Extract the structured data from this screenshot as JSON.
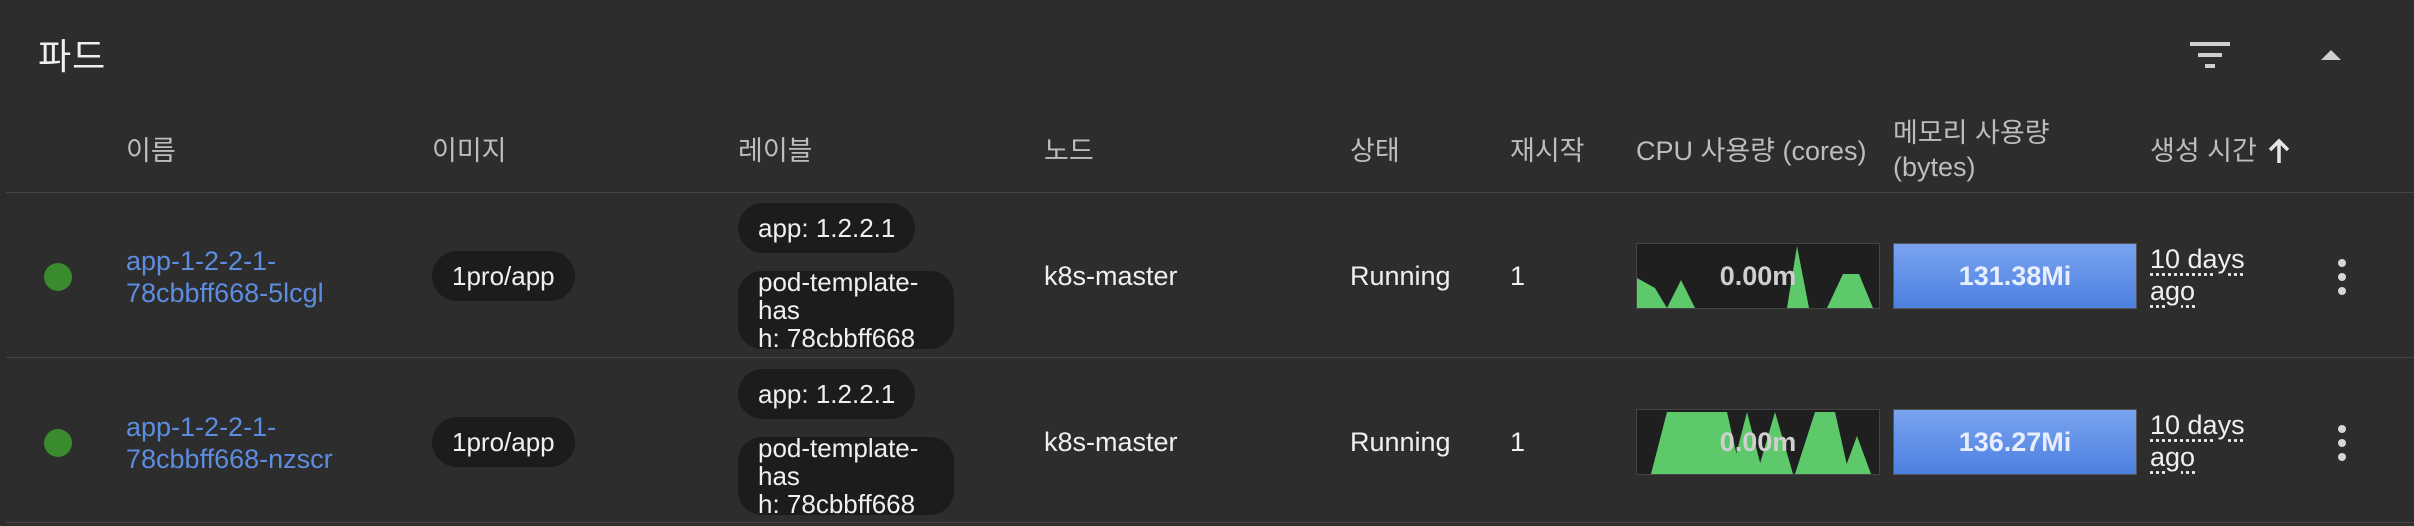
{
  "card": {
    "title": "파드"
  },
  "columns": {
    "name": "이름",
    "image": "이미지",
    "labels": "레이블",
    "node": "노드",
    "status": "상태",
    "restarts": "재시작",
    "cpu": "CPU 사용량 (cores)",
    "memory_line1": "메모리 사용량",
    "memory_line2": "(bytes)",
    "created": "생성 시간",
    "sort_icon": "arrow-up-icon"
  },
  "icons": {
    "filter": "filter-icon",
    "collapse": "chevron-up-icon",
    "status": "status-dot-icon",
    "menu": "more-vertical-icon"
  },
  "colors": {
    "status_running": "#3a8a2e",
    "link": "#5c8de0",
    "cpu_graph": "#5dc96a",
    "memory_bar": "#6a97ea"
  },
  "rows": [
    {
      "name_line1": "app-1-2-2-1-",
      "name_line2": "78cbbff668-5lcgl",
      "image": "1pro/app",
      "label1": "app: 1.2.2.1",
      "label2_line1": "pod-template-has",
      "label2_line2": "h: 78cbbff668",
      "node": "k8s-master",
      "status": "Running",
      "restarts": "1",
      "cpu": "0.00m",
      "memory": "131.38Mi",
      "age_line1": "10 days",
      "age_line2": "ago"
    },
    {
      "name_line1": "app-1-2-2-1-",
      "name_line2": "78cbbff668-nzscr",
      "image": "1pro/app",
      "label1": "app: 1.2.2.1",
      "label2_line1": "pod-template-has",
      "label2_line2": "h: 78cbbff668",
      "node": "k8s-master",
      "status": "Running",
      "restarts": "1",
      "cpu": "0.00m",
      "memory": "136.27Mi",
      "age_line1": "10 days",
      "age_line2": "ago"
    }
  ]
}
